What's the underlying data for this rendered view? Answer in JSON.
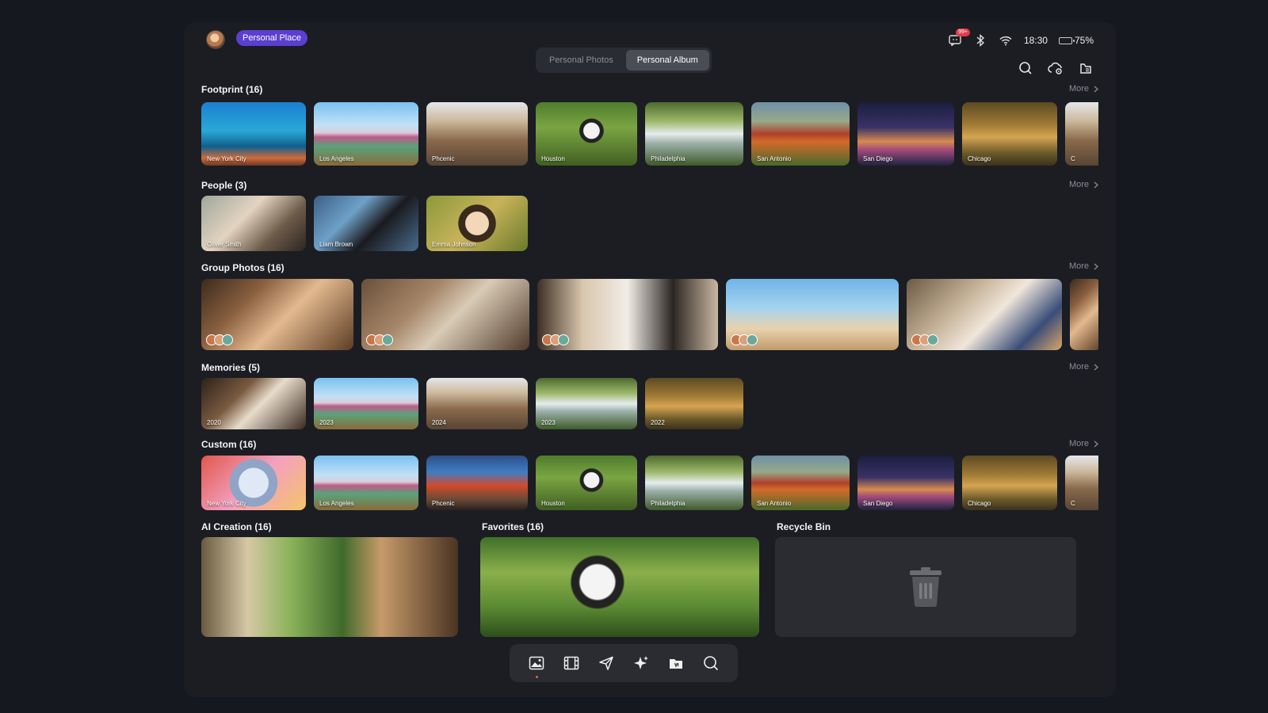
{
  "header": {
    "place_label": "Personal Place",
    "tabs": [
      {
        "label": "Personal Photos",
        "active": false
      },
      {
        "label": "Personal Album",
        "active": true
      }
    ]
  },
  "status": {
    "message_badge": "99+",
    "time": "18:30",
    "battery": "75%",
    "battery_level": 0.75,
    "icons": [
      "message-icon",
      "bluetooth-icon",
      "wifi-icon",
      "battery-icon"
    ]
  },
  "toolbar": {
    "icons": [
      "search-icon",
      "cloud-settings-icon",
      "album-list-icon"
    ]
  },
  "sections": {
    "footprint": {
      "title": "Footprint (16)",
      "more": "More",
      "items": [
        "New York City",
        "Los Angeles",
        "Phcenic",
        "Houston",
        "Philadelphia",
        "San Antonio",
        "San Diego",
        "Chicago",
        "C"
      ]
    },
    "people": {
      "title": "People (3)",
      "more": "More",
      "items": [
        "Oliver Smith",
        "Liam Brown",
        "Emma Johnson"
      ]
    },
    "group": {
      "title": "Group Photos (16)",
      "more": "More"
    },
    "memories": {
      "title": "Memories (5)",
      "more": "More",
      "items": [
        "2020",
        "2023",
        "2024",
        "2023",
        "2022"
      ]
    },
    "custom": {
      "title": "Custom (16)",
      "more": "More",
      "items": [
        "New York City",
        "Los Angeles",
        "Phcenic",
        "Houston",
        "Philadelphia",
        "San Antonio",
        "San Diego",
        "Chicago",
        "C"
      ]
    },
    "ai_creation": {
      "title": "AI Creation (16)"
    },
    "favorites": {
      "title": "Favorites (16)"
    },
    "recycle_bin": {
      "title": "Recycle Bin"
    }
  },
  "dock": {
    "icons": [
      "gallery-icon",
      "video-icon",
      "share-icon",
      "ai-sparkle-icon",
      "album-icon",
      "search-icon"
    ],
    "active": "gallery-icon"
  }
}
